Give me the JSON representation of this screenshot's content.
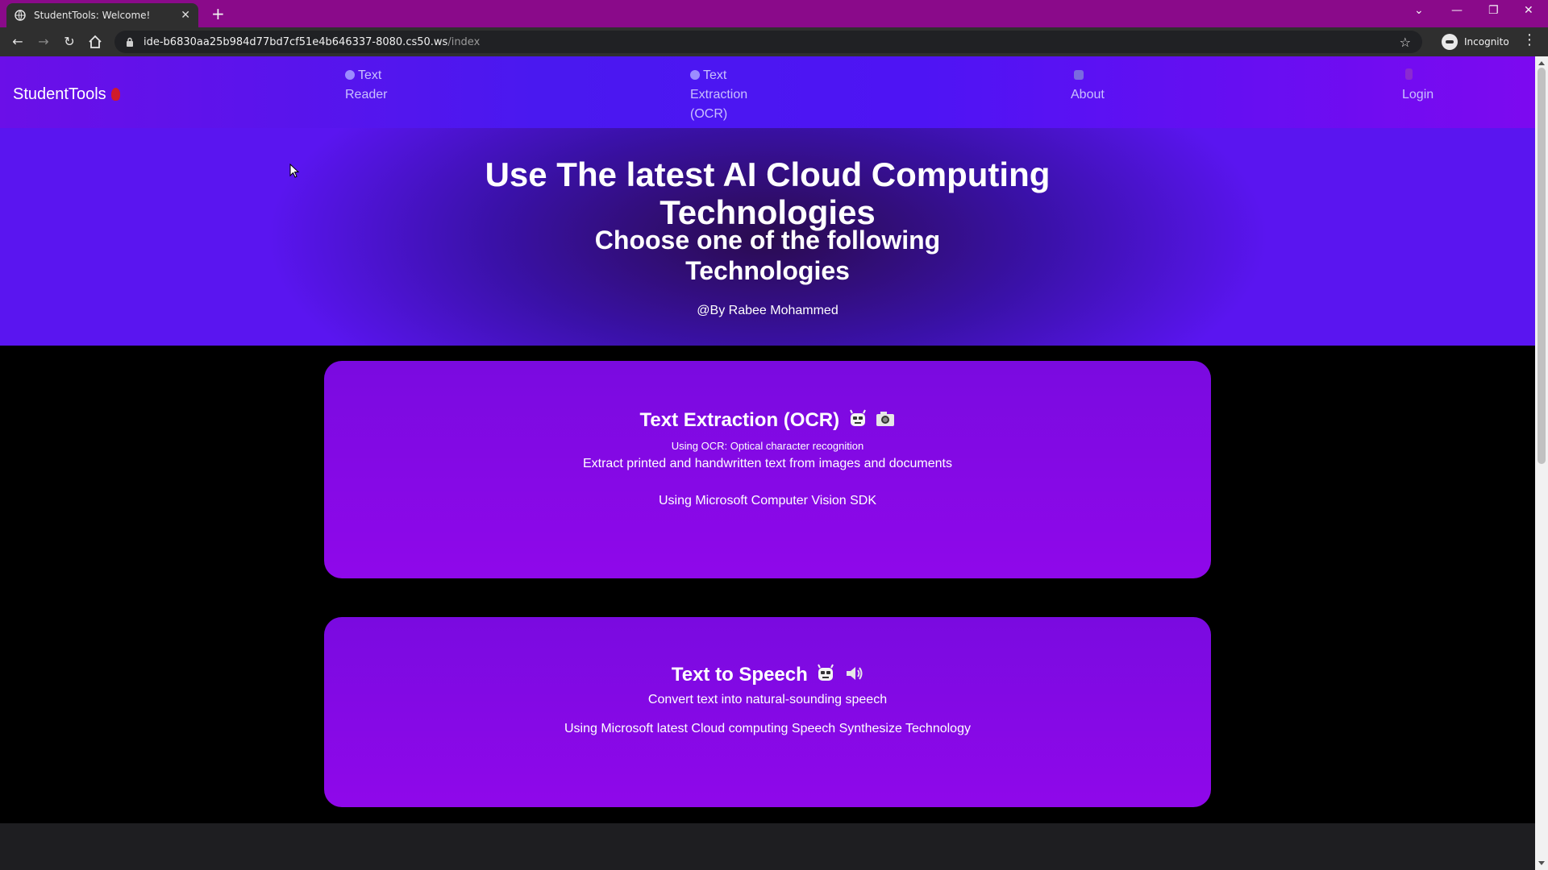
{
  "browser": {
    "tab_title": "StudentTools: Welcome!",
    "url_host": "ide-b6830aa25b984d77bd7cf51e4b646337-8080.cs50.ws",
    "url_path": "/index",
    "profile_label": "Incognito"
  },
  "nav": {
    "brand": "StudentTools",
    "links": [
      {
        "line1": "Text",
        "line2": "Reader",
        "line3": "",
        "icon": "flower-icon"
      },
      {
        "line1": "Text",
        "line2": "Extraction",
        "line3": "(OCR)",
        "icon": "flower-icon"
      },
      {
        "line1": "",
        "line2": "About",
        "line3": "",
        "icon": "book-icon"
      },
      {
        "line1": "",
        "line2": "Login",
        "line3": "",
        "icon": "phone-icon"
      }
    ]
  },
  "hero": {
    "title_line1": "Use The latest AI Cloud Computing",
    "title_line2": "Technologies",
    "subtitle_line1": "Choose one of the following",
    "subtitle_line2": "Technologies",
    "author": "@By Rabee Mohammed"
  },
  "cards": [
    {
      "title": "Text Extraction (OCR)",
      "note": "Using OCR: Optical character recognition",
      "description": "Extract printed and handwritten text from images and documents",
      "tech": "Using Microsoft Computer Vision SDK",
      "emojis": [
        "robot-icon",
        "camera-icon"
      ]
    },
    {
      "title": "Text to Speech",
      "description": "Convert text into natural-sounding speech",
      "tech": "Using Microsoft latest Cloud computing Speech Synthesize Technology",
      "emojis": [
        "robot-icon",
        "speaker-icon"
      ]
    }
  ],
  "colors": {
    "tabbar": "#8a0a8a",
    "nav_accent": "#4e14f4",
    "card": "#8b08e8"
  }
}
